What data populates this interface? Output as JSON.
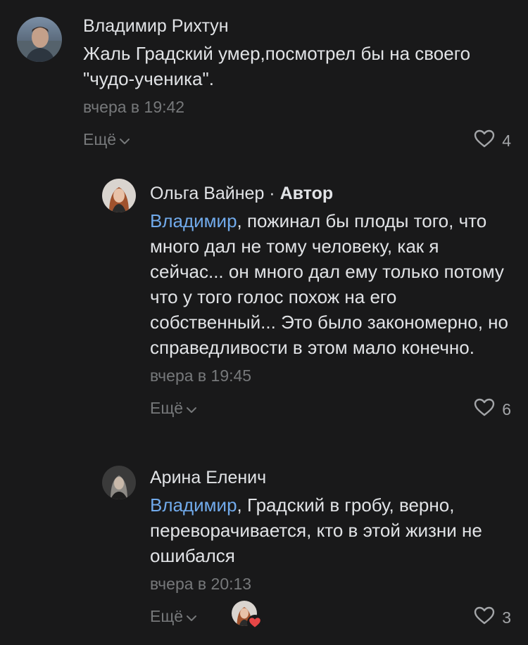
{
  "comments": [
    {
      "author": "Владимир Рихтун",
      "text": "Жаль Градский умер,посмотрел бы на своего \"чудо-ученика\".",
      "time": "вчера в 19:42",
      "more_label": "Ещё",
      "likes": "4"
    },
    {
      "author": "Ольга Вайнер",
      "separator": " · ",
      "role": "Автор",
      "mention": "Владимир",
      "text": ", пожинал бы плоды того, что много дал не тому человеку, как я сейчас... он много дал ему только потому что у того голос похож на его собственный... Это было закономерно, но справедливости в этом мало конечно.",
      "time": "вчера в 19:45",
      "more_label": "Ещё",
      "likes": "6"
    },
    {
      "author": "Арина Еленич",
      "mention": "Владимир",
      "text": ", Градский в гробу, верно, переворачивается, кто в этой жизни не ошибался",
      "time": "вчера в 20:13",
      "more_label": "Ещё",
      "likes": "3"
    }
  ],
  "icons": {
    "heart": "heart-outline-icon",
    "chevron": "chevron-down-icon",
    "liked_badge": "red-heart-icon"
  },
  "colors": {
    "background": "#19191a",
    "text": "#e1e3e6",
    "secondary": "#76787a",
    "mention": "#71aaeb",
    "like_badge": "#e64646"
  }
}
